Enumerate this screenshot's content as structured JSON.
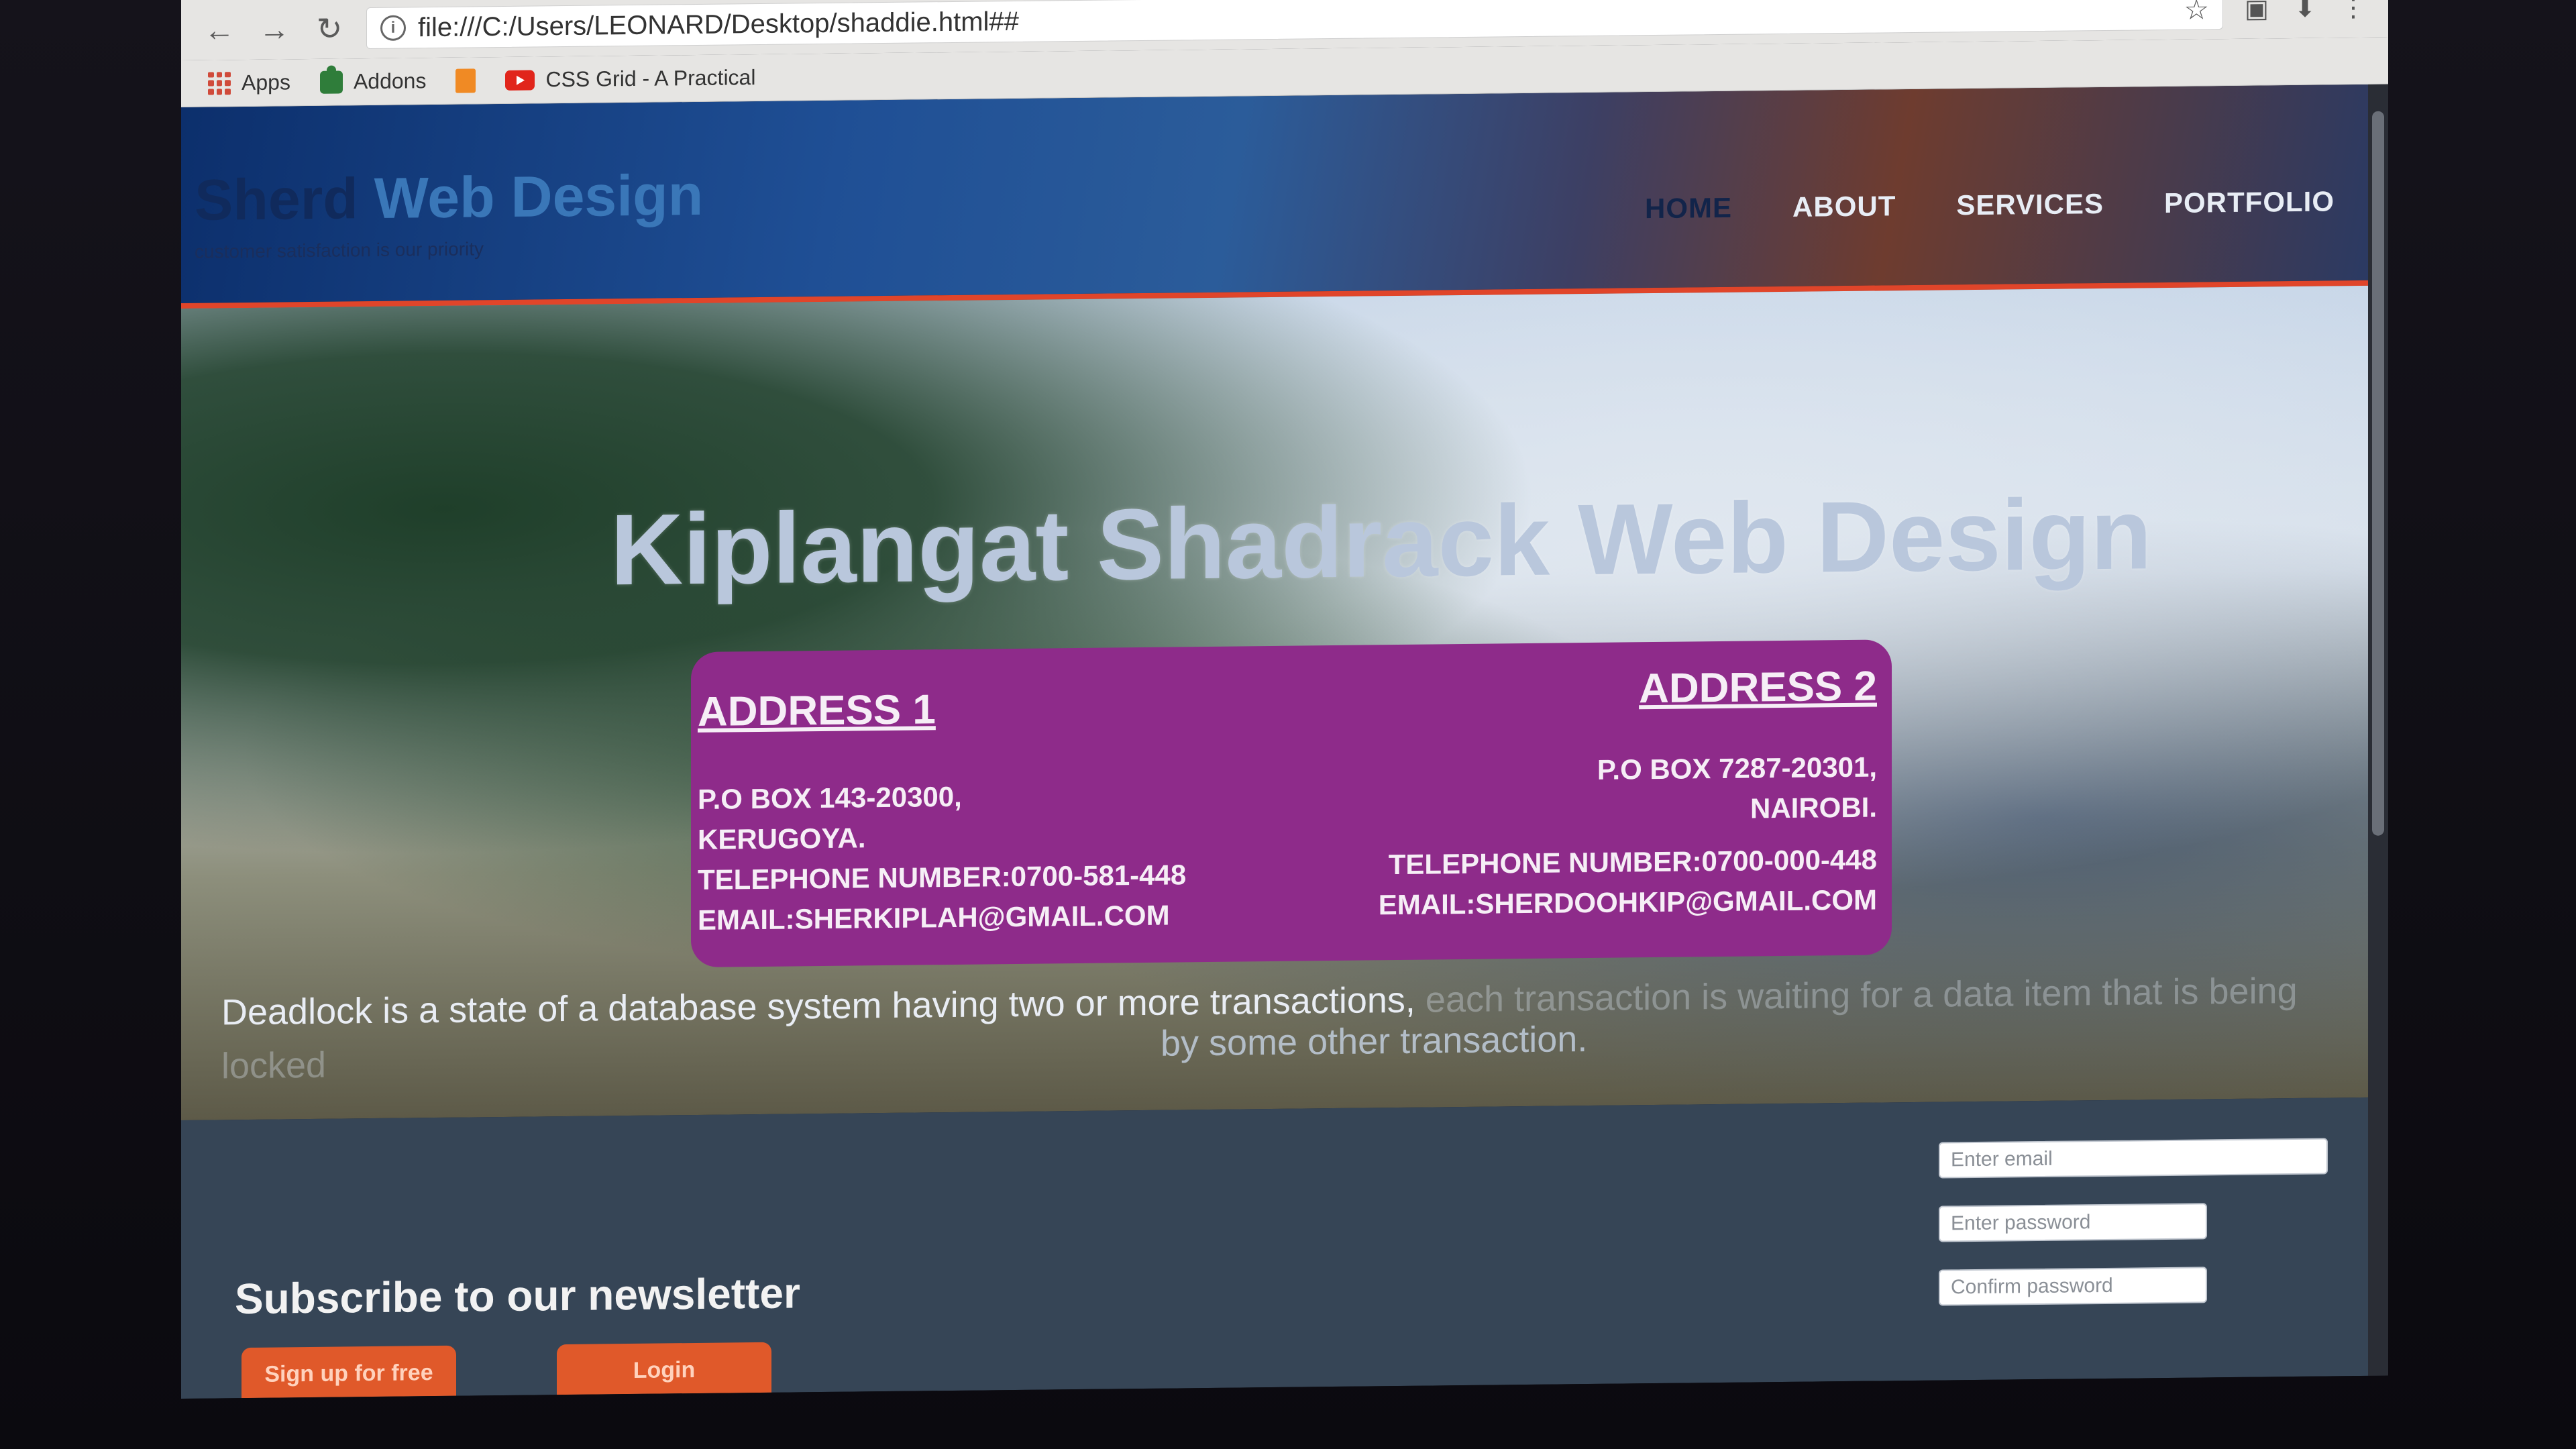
{
  "browser": {
    "url": "file:///C:/Users/LEONARD/Desktop/shaddie.html##",
    "bookmarks": [
      {
        "label": "Apps"
      },
      {
        "label": "Addons"
      },
      {
        "label": ""
      },
      {
        "label": "CSS Grid - A Practical"
      }
    ]
  },
  "site": {
    "brand_prefix": "Sherd",
    "brand_suffix": " Web Design",
    "tagline": "customer satisfaction is our priority",
    "nav": [
      {
        "label": "HOME",
        "active": true
      },
      {
        "label": "ABOUT"
      },
      {
        "label": "SERVICES"
      },
      {
        "label": "PORTFOLIO"
      }
    ]
  },
  "hero": {
    "title": "Kiplangat Shadrack Web Design",
    "address1": {
      "heading": "ADDRESS 1",
      "box": "P.O BOX 143-20300,",
      "town": "KERUGOYA.",
      "phone": "TELEPHONE NUMBER:0700-581-448",
      "email": "EMAIL:SHERKIPLAH@GMAIL.COM"
    },
    "address2": {
      "heading": "ADDRESS 2",
      "box": "P.O BOX 7287-20301,",
      "town": "NAIROBI.",
      "phone": "TELEPHONE NUMBER:0700-000-448",
      "email": "EMAIL:SHERDOOHKIP@GMAIL.COM"
    },
    "text_line1_start": "Deadlock is a state of a database system having two or more transactions, ",
    "text_line1_end": "each transaction is waiting for a data item that is being locked",
    "text_line2": "by some other transaction."
  },
  "newsletter": {
    "title": "Subscribe to our newsletter",
    "signup_label": "Sign up for free",
    "login_label": "Login",
    "email_placeholder": "Enter email",
    "password_placeholder": "Enter password",
    "confirm_placeholder": "Confirm password"
  },
  "colors": {
    "header_accent": "#e0452a",
    "address_card": "#8e2b8a",
    "button": "#e0592a",
    "footer_bg": "#364556"
  }
}
